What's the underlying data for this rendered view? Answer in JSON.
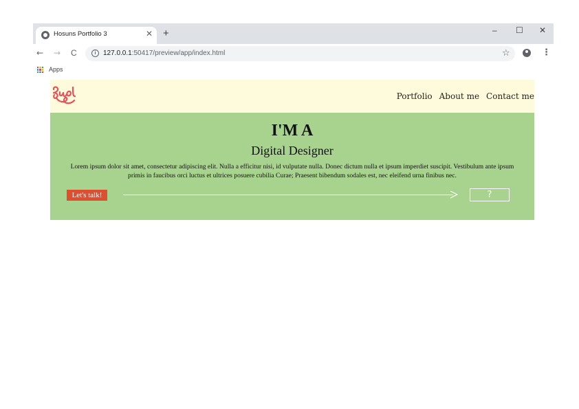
{
  "browser": {
    "tab_title": "Hosuns Portfolio 3",
    "tab_close": "✕",
    "new_tab": "+",
    "window_controls": {
      "minimize": "–",
      "maximize": "☐",
      "close": "✕"
    },
    "nav": {
      "back": "←",
      "forward": "→",
      "reload": "C"
    },
    "url_host": "127.0.0.1",
    "url_path": ":50417/preview/app/index.html",
    "info_icon": "i",
    "star": "☆",
    "menu": "⋮",
    "bookmarks": {
      "apps_label": "Apps"
    },
    "icons": [
      "globe-icon",
      "info-icon",
      "star-icon",
      "account-icon",
      "apps-grid-icon"
    ]
  },
  "site": {
    "logo_text": "Buol",
    "nav_items": [
      "Portfolio",
      "About me",
      "Contact me"
    ],
    "hero": {
      "heading": "I'M A",
      "subheading": "Digital Designer",
      "paragraph": "Lorem ipsum dolor sit amet, consectetur adipiscing elit. Nulla a efficitur nisi, id vulputate nulla. Donec dictum nulla et ipsum imperdiet suscipit. Vestibulum ante ipsum primis in faucibus orci luctus et ultrices posuere cubilia Curae; Praesent bibendum sodales est, nec eleifend urna finibus nec.",
      "cta_label": "Let's talk!",
      "question": "?"
    },
    "colors": {
      "header_bg": "#fefbdc",
      "hero_bg": "#a8d38e",
      "cta_bg": "#e04e30",
      "logo": "#e8505b"
    }
  }
}
